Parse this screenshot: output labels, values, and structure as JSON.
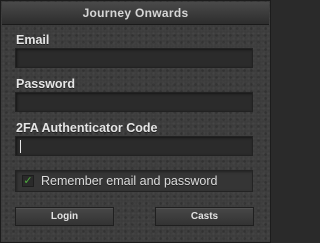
{
  "window": {
    "title": "Journey Onwards"
  },
  "form": {
    "email": {
      "label": "Email",
      "value": "",
      "placeholder": ""
    },
    "password": {
      "label": "Password",
      "value": "",
      "placeholder": ""
    },
    "twofa": {
      "label": "2FA Authenticator Code",
      "value": "",
      "placeholder": ""
    },
    "remember": {
      "label": "Remember email and password",
      "checked": true,
      "check_glyph": "✓"
    }
  },
  "buttons": {
    "login_label": "Login",
    "casts_label": "Casts"
  },
  "colors": {
    "check": "#4fae3e"
  }
}
